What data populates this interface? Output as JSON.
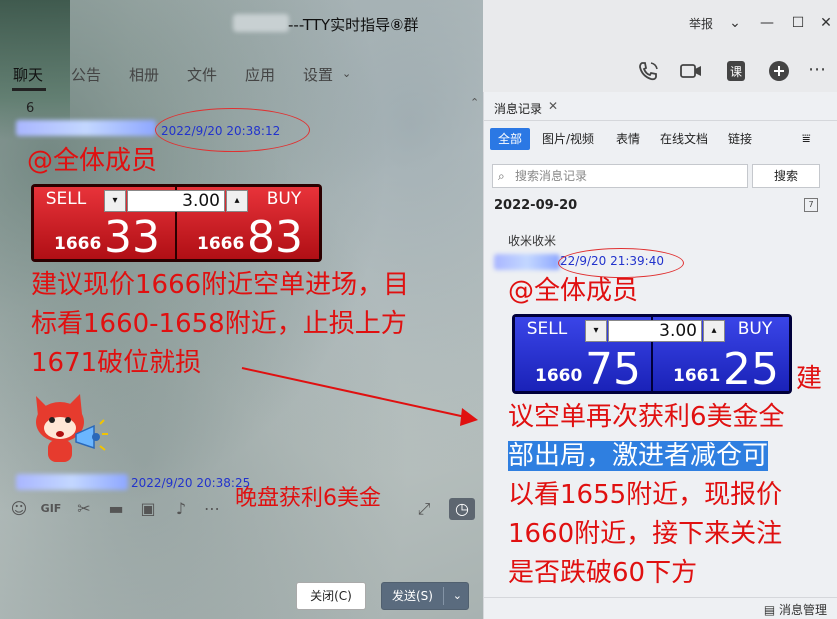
{
  "window": {
    "title": "---TTY实时指导⑧群",
    "report": "举报"
  },
  "tabs": [
    "聊天",
    "公告",
    "相册",
    "文件",
    "应用",
    "设置"
  ],
  "chat": {
    "unread": "6",
    "msg1": {
      "timestamp": "2022/9/20 20:38:12",
      "mention": "@全体成员",
      "widget": {
        "sell_label": "SELL",
        "buy_label": "BUY",
        "qty": "3.00",
        "sell_small": "1666",
        "sell_big": "33",
        "buy_small": "1666",
        "buy_big": "83"
      },
      "text_line1": "建议现价1666附近空单进场，目",
      "text_line2": "标看1660-1658附近，止损上方",
      "text_line3": "1671破位就损"
    },
    "msg2": {
      "timestamp": "2022/9/20 20:38:25"
    },
    "overlay_text": "晚盘获利6美金"
  },
  "buttons": {
    "close": "关闭(C)",
    "send": "发送(S)"
  },
  "history": {
    "tab": "消息记录",
    "filters": [
      "全部",
      "图片/视频",
      "表情",
      "在线文档",
      "链接"
    ],
    "search_placeholder": "搜索消息记录",
    "search_button": "搜索",
    "date": "2022-09-20",
    "prev_msg": "收米收米",
    "timestamp": "22/9/20 21:39:40",
    "mention": "@全体成员",
    "widget": {
      "sell_label": "SELL",
      "buy_label": "BUY",
      "qty": "3.00",
      "sell_small": "1660",
      "sell_big": "75",
      "buy_small": "1661",
      "buy_big": "25"
    },
    "text_line0": "建",
    "text_line1": "议空单再次获利6美金全",
    "text_line2": "部出局，激进者减仓可",
    "text_line3": "以看1655附近，现报价",
    "text_line4": "1660附近，接下来关注",
    "text_line5": "是否跌破60下方",
    "manage": "消息管理"
  },
  "colors": {
    "red_text": "#e01010",
    "red_widget": "#c8141a",
    "blue_widget": "#1f27c8",
    "accent": "#2b78e4"
  }
}
